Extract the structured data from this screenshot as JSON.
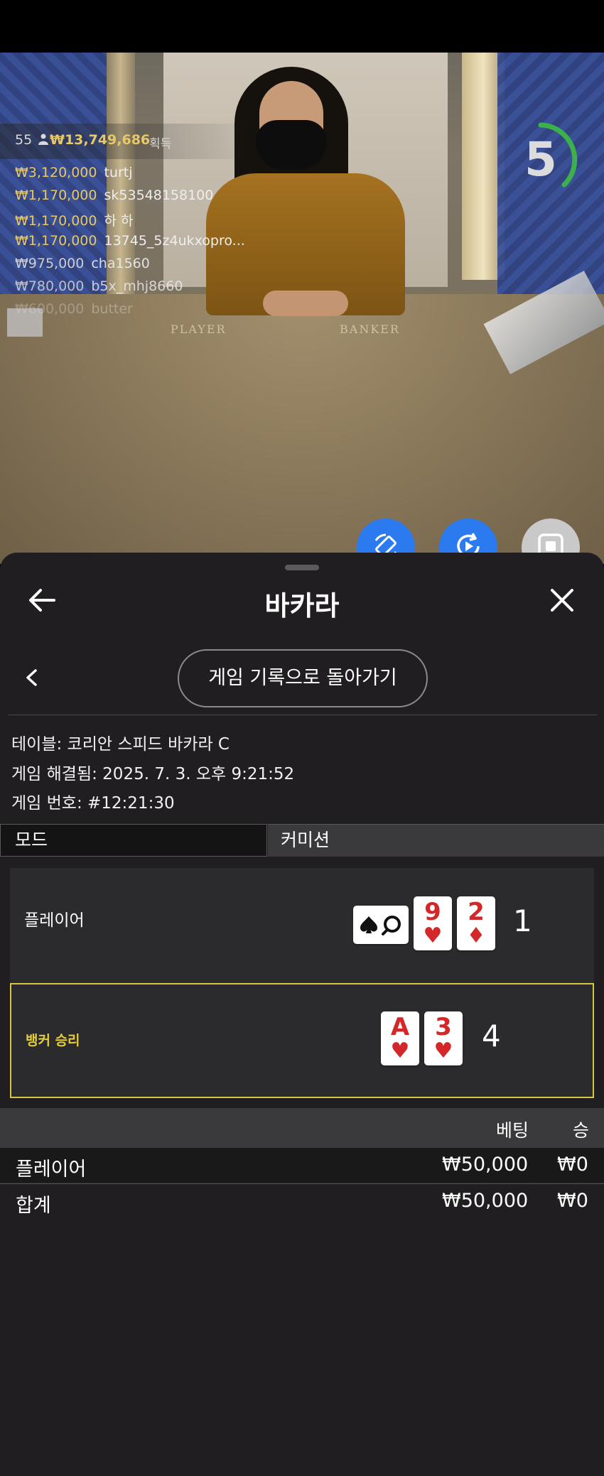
{
  "live": {
    "timer": "5",
    "table_labels": {
      "player": "PLAYER",
      "banker": "BANKER"
    },
    "winners_summary": {
      "count": "55",
      "total": "₩13,749,686",
      "suffix": "획득"
    },
    "winners": [
      {
        "amount": "₩3,120,000",
        "name": "turtj"
      },
      {
        "amount": "₩1,170,000",
        "name": "sk53548158100"
      },
      {
        "amount": "₩1,170,000",
        "name": "하 하"
      },
      {
        "amount": "₩1,170,000",
        "name": "13745_5z4ukxopro..."
      },
      {
        "amount": "₩975,000",
        "name": "cha1560"
      },
      {
        "amount": "₩780,000",
        "name": "b5x_mhj8660"
      },
      {
        "amount": "₩600,000",
        "name": "butter"
      }
    ]
  },
  "sheet": {
    "title": "바카라",
    "back_to_history": "게임 기록으로 돌아가기",
    "info": {
      "table": "테이블: 코리안 스피드 바카라 C",
      "resolved": "게임 해결됨: 2025. 7. 3. 오후 9:21:52",
      "game_no": "게임 번호: #12:21:30"
    },
    "tabs": {
      "mode": "모드",
      "commission": "커미션"
    },
    "player_hand": {
      "label": "플레이어",
      "score": "1",
      "cards": [
        {
          "rank": "9",
          "suit": "♥"
        },
        {
          "rank": "2",
          "suit": "♦"
        }
      ]
    },
    "banker_hand": {
      "label": "뱅커 승리",
      "score": "4",
      "cards": [
        {
          "rank": "A",
          "suit": "♥"
        },
        {
          "rank": "3",
          "suit": "♥"
        }
      ]
    },
    "bets": {
      "headers": {
        "bet": "베팅",
        "win": "승"
      },
      "rows": [
        {
          "label": "플레이어",
          "bet": "₩50,000",
          "win": "₩0"
        },
        {
          "label": "합계",
          "bet": "₩50,000",
          "win": "₩0"
        }
      ]
    }
  },
  "colors": {
    "accent_blue": "#2b7af0",
    "gold": "#e6c868",
    "winner_highlight": "#d6c640",
    "card_red": "#d3282a",
    "sheet_bg": "#201e20"
  },
  "icons": [
    "arrow-left-icon",
    "close-icon",
    "chevron-left-icon",
    "rotate-icon",
    "replay-icon",
    "stop-icon",
    "person-icon",
    "spade-logo-icon"
  ]
}
